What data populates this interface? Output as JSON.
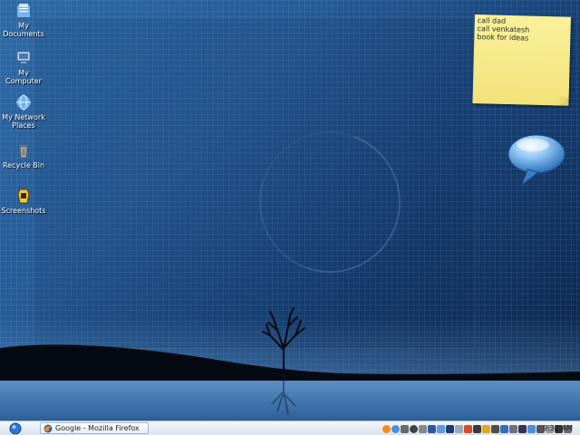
{
  "desktop": {
    "icons": [
      {
        "name": "my-documents-icon",
        "label": "My Documents"
      },
      {
        "name": "my-computer-icon",
        "label": "My Computer"
      },
      {
        "name": "my-network-places-icon",
        "label": "My Network Places"
      },
      {
        "name": "recycle-bin-icon",
        "label": "Recycle Bin"
      },
      {
        "name": "screenshots-folder-icon",
        "label": "Screenshots"
      }
    ]
  },
  "sticky_note": {
    "lines": [
      "call dad",
      "call venkatesh",
      "book for ideas"
    ]
  },
  "speech_bubble": {
    "icon": "speech-bubble-icon"
  },
  "taskbar": {
    "start_icon": "start-orb-icon",
    "window_title": "Google - Mozilla Firefox",
    "window_icon": "firefox-icon",
    "clock": "9:31 AM",
    "tray_icons": [
      "firefox-icon",
      "chat-icon",
      "network-icon",
      "clock-icon",
      "settings-icon",
      "monitor-icon",
      "app-icon",
      "app-icon",
      "app-icon",
      "app-icon",
      "app-icon",
      "app-icon",
      "app-icon",
      "app-icon",
      "app-icon",
      "app-icon",
      "app-icon",
      "volume-icon",
      "app-icon",
      "app-icon",
      "app-icon"
    ],
    "colors": {
      "bar_top": "#f4f7fb",
      "bar_bottom": "#d9e3ef"
    }
  }
}
